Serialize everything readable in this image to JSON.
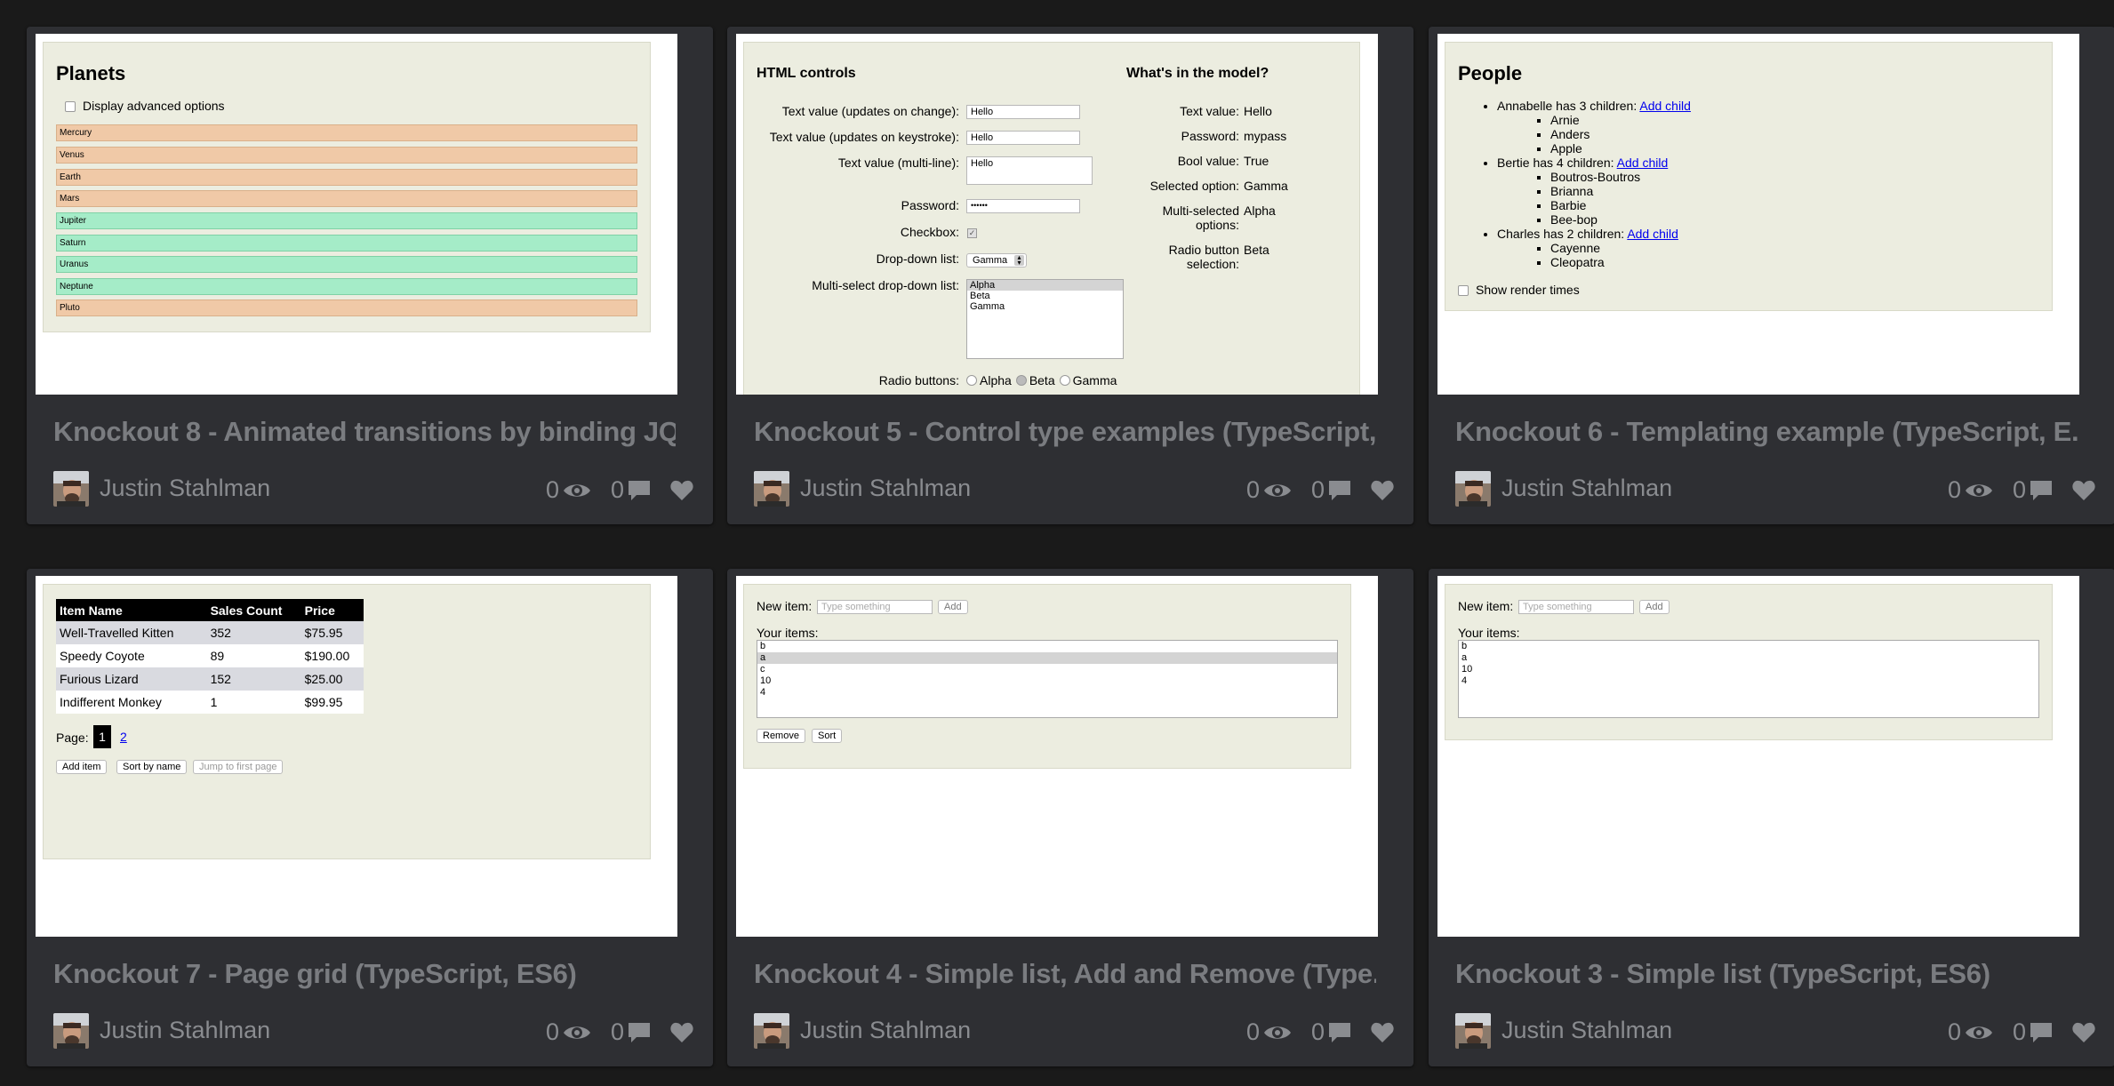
{
  "cards": [
    {
      "title": "Knockout 8 - Animated transitions by binding JQ...",
      "author": "Justin Stahlman",
      "views": "0",
      "comments": "0",
      "demo": {
        "heading": "Planets",
        "checkbox_label": "Display advanced options",
        "planets": [
          {
            "name": "Mercury",
            "kind": "rock"
          },
          {
            "name": "Venus",
            "kind": "rock"
          },
          {
            "name": "Earth",
            "kind": "rock"
          },
          {
            "name": "Mars",
            "kind": "rock"
          },
          {
            "name": "Jupiter",
            "kind": "gas"
          },
          {
            "name": "Saturn",
            "kind": "gas"
          },
          {
            "name": "Uranus",
            "kind": "gas"
          },
          {
            "name": "Neptune",
            "kind": "gas"
          },
          {
            "name": "Pluto",
            "kind": "rock"
          }
        ]
      }
    },
    {
      "title": "Knockout 5 - Control type examples (TypeScript,...",
      "author": "Justin Stahlman",
      "views": "0",
      "comments": "0",
      "demo": {
        "heading_left": "HTML controls",
        "heading_right": "What's in the model?",
        "text_change_label": "Text value (updates on change):",
        "text_change_value": "Hello",
        "text_key_label": "Text value (updates on keystroke):",
        "text_key_value": "Hello",
        "multiline_label": "Text value (multi-line):",
        "multiline_value": "Hello",
        "password_label": "Password:",
        "password_value": "••••••",
        "checkbox_label": "Checkbox:",
        "dropdown_label": "Drop-down list:",
        "dropdown_value": "Gamma",
        "multiselect_label": "Multi-select drop-down list:",
        "multiselect_options": [
          "Alpha",
          "Beta",
          "Gamma"
        ],
        "radio_label": "Radio buttons:",
        "radio_options": [
          "Alpha",
          "Beta",
          "Gamma"
        ],
        "model": [
          {
            "label": "Text value:",
            "value": "Hello"
          },
          {
            "label": "Password:",
            "value": "mypass"
          },
          {
            "label": "Bool value:",
            "value": "True"
          },
          {
            "label": "Selected option:",
            "value": "Gamma"
          },
          {
            "label": "Multi-selected options:",
            "value": "Alpha"
          },
          {
            "label": "Radio button selection:",
            "value": "Beta"
          }
        ]
      }
    },
    {
      "title": "Knockout 6 - Templating example (TypeScript, E...",
      "author": "Justin Stahlman",
      "views": "0",
      "comments": "0",
      "demo": {
        "heading": "People",
        "add_child": "Add child",
        "people": [
          {
            "text": "Annabelle has 3 children:",
            "children": [
              "Arnie",
              "Anders",
              "Apple"
            ]
          },
          {
            "text": "Bertie has 4 children:",
            "children": [
              "Boutros-Boutros",
              "Brianna",
              "Barbie",
              "Bee-bop"
            ]
          },
          {
            "text": "Charles has 2 children:",
            "children": [
              "Cayenne",
              "Cleopatra"
            ]
          }
        ],
        "checkbox_label": "Show render times"
      }
    },
    {
      "title": "Knockout 7 - Page grid (TypeScript, ES6)",
      "author": "Justin Stahlman",
      "views": "0",
      "comments": "0",
      "demo": {
        "headers": [
          "Item Name",
          "Sales Count",
          "Price"
        ],
        "rows": [
          [
            "Well-Travelled Kitten",
            "352",
            "$75.95"
          ],
          [
            "Speedy Coyote",
            "89",
            "$190.00"
          ],
          [
            "Furious Lizard",
            "152",
            "$25.00"
          ],
          [
            "Indifferent Monkey",
            "1",
            "$99.95"
          ]
        ],
        "page_label": "Page:",
        "pages": [
          "1",
          "2"
        ],
        "buttons": [
          "Add item",
          "Sort by name",
          "Jump to first page"
        ]
      }
    },
    {
      "title": "Knockout 4 - Simple list, Add and Remove (Type...",
      "author": "Justin Stahlman",
      "views": "0",
      "comments": "0",
      "demo": {
        "new_item_label": "New item:",
        "placeholder": "Type something",
        "add_label": "Add",
        "your_items_label": "Your items:",
        "items": [
          "b",
          "a",
          "c",
          "10",
          "4"
        ],
        "remove_label": "Remove",
        "sort_label": "Sort"
      }
    },
    {
      "title": "Knockout 3 - Simple list (TypeScript, ES6)",
      "author": "Justin Stahlman",
      "views": "0",
      "comments": "0",
      "demo": {
        "new_item_label": "New item:",
        "placeholder": "Type something",
        "add_label": "Add",
        "your_items_label": "Your items:",
        "items": [
          "b",
          "a",
          "10",
          "4"
        ]
      }
    }
  ],
  "icons": {
    "views": "eye-icon",
    "comments": "speech-bubble-icon",
    "like": "heart-icon"
  }
}
